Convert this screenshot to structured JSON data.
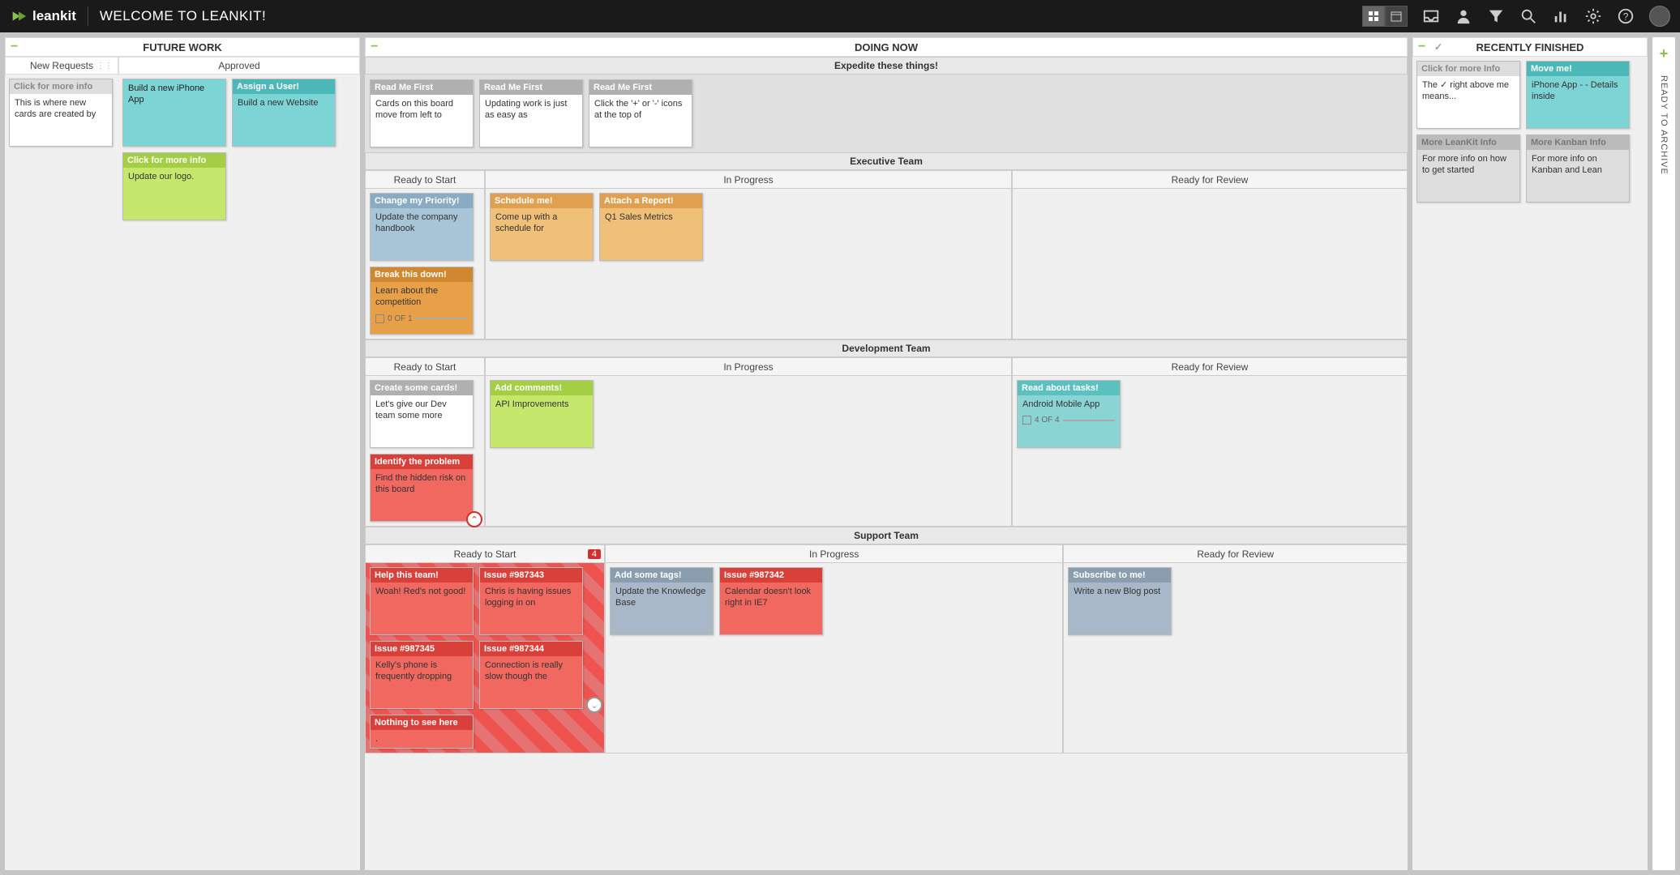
{
  "header": {
    "brand": "leankit",
    "title": "WELCOME TO LEANKIT!"
  },
  "archive_label": "READY TO ARCHIVE",
  "columns": {
    "future": {
      "title": "FUTURE WORK",
      "sub": {
        "new_requests": "New Requests",
        "approved": "Approved"
      }
    },
    "doing": {
      "title": "DOING NOW",
      "expedite": "Expedite these things!",
      "exec": "Executive Team",
      "dev": "Development Team",
      "support": "Support Team",
      "ready": "Ready to Start",
      "progress": "In Progress",
      "review": "Ready for Review",
      "badge": "4"
    },
    "finished": {
      "title": "RECENTLY FINISHED"
    }
  },
  "cards": {
    "new_req": {
      "hdr": "Click for more info",
      "body": "This is where new cards are created by"
    },
    "app": {
      "body": "Build a new iPhone App"
    },
    "assign": {
      "hdr": "Assign a User!",
      "body": "Build a new Website"
    },
    "logo": {
      "hdr": "Click for more info",
      "body": "Update our logo."
    },
    "rm1": {
      "hdr": "Read Me First",
      "body": "Cards on this board move from left to"
    },
    "rm2": {
      "hdr": "Read Me First",
      "body": "Updating work is just as easy as"
    },
    "rm3": {
      "hdr": "Read Me First",
      "body": "Click the '+' or '-' icons at the top of"
    },
    "priority": {
      "hdr": "Change my Priority!",
      "body": "Update the company handbook"
    },
    "break": {
      "hdr": "Break this down!",
      "body": "Learn about the competition",
      "prog": "0 OF 1"
    },
    "sched": {
      "hdr": "Schedule me!",
      "body": "Come up with a schedule for"
    },
    "attach": {
      "hdr": "Attach a Report!",
      "body": "Q1 Sales Metrics"
    },
    "create": {
      "hdr": "Create some cards!",
      "body": "Let's give our Dev team some more"
    },
    "identify": {
      "hdr": "Identify the problem",
      "body": "Find the hidden risk on this board"
    },
    "comments": {
      "hdr": "Add comments!",
      "body": "API Improvements"
    },
    "tasks": {
      "hdr": "Read about tasks!",
      "body": "Android Mobile App",
      "prog": "4 OF 4"
    },
    "help": {
      "hdr": "Help this team!",
      "body": "Woah! Red's not good!"
    },
    "i43": {
      "hdr": "Issue #987343",
      "body": "Chris is having issues logging in on"
    },
    "i45": {
      "hdr": "Issue #987345",
      "body": "Kelly's phone is frequently dropping"
    },
    "i44": {
      "hdr": "Issue #987344",
      "body": "Connection is really slow though the"
    },
    "nothing": {
      "hdr": "Nothing to see here",
      "body": "."
    },
    "tags": {
      "hdr": "Add some tags!",
      "body": "Update the Knowledge Base"
    },
    "i42": {
      "hdr": "Issue #987342",
      "body": "Calendar doesn't look right in IE7"
    },
    "sub": {
      "hdr": "Subscribe to me!",
      "body": "Write a new Blog post"
    },
    "f1": {
      "hdr": "Click for more Info",
      "body": "The ✓ right above me means..."
    },
    "f2": {
      "hdr": "Move me!",
      "body": "iPhone App - - Details inside"
    },
    "f3": {
      "hdr": "More LeanKit Info",
      "body": "For more info on how to get started"
    },
    "f4": {
      "hdr": "More Kanban Info",
      "body": "For more info on Kanban and Lean"
    }
  }
}
